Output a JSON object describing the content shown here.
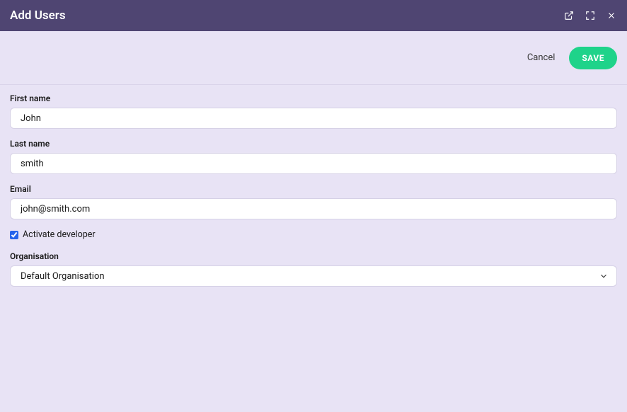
{
  "header": {
    "title": "Add Users"
  },
  "actions": {
    "cancel_label": "Cancel",
    "save_label": "SAVE"
  },
  "form": {
    "first_name": {
      "label": "First name",
      "value": "John"
    },
    "last_name": {
      "label": "Last name",
      "value": "smith"
    },
    "email": {
      "label": "Email",
      "value": "john@smith.com"
    },
    "activate_developer": {
      "label": "Activate developer",
      "checked": true
    },
    "organisation": {
      "label": "Organisation",
      "value": "Default Organisation"
    }
  }
}
